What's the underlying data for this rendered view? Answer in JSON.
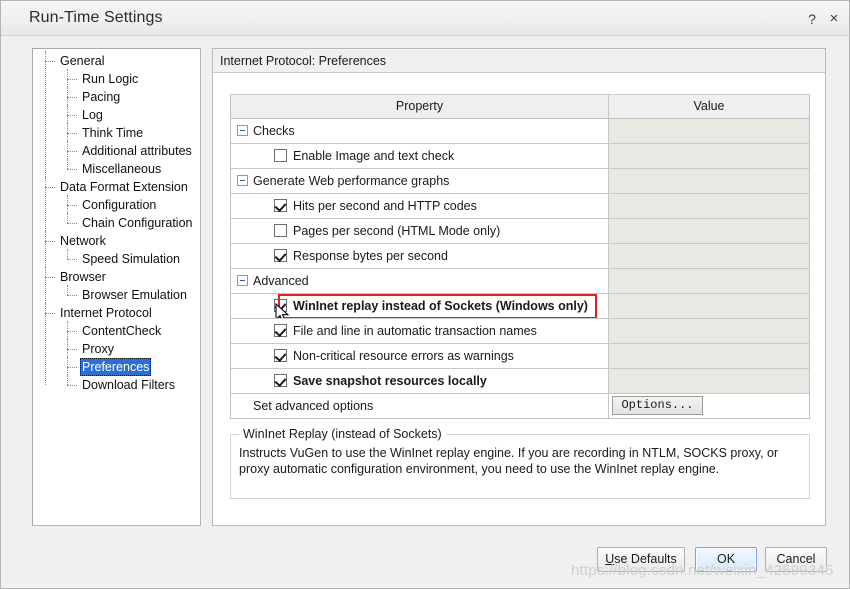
{
  "window": {
    "title": "Run-Time Settings",
    "help_icon": "?",
    "close_icon": "×"
  },
  "tree": {
    "nodes": [
      {
        "label": "General",
        "level": 0,
        "selected": false
      },
      {
        "label": "Run Logic",
        "level": 1,
        "selected": false
      },
      {
        "label": "Pacing",
        "level": 1,
        "selected": false
      },
      {
        "label": "Log",
        "level": 1,
        "selected": false
      },
      {
        "label": "Think Time",
        "level": 1,
        "selected": false
      },
      {
        "label": "Additional attributes",
        "level": 1,
        "selected": false
      },
      {
        "label": "Miscellaneous",
        "level": 1,
        "selected": false
      },
      {
        "label": "Data Format Extension",
        "level": 0,
        "selected": false
      },
      {
        "label": "Configuration",
        "level": 1,
        "selected": false
      },
      {
        "label": "Chain Configuration",
        "level": 1,
        "selected": false
      },
      {
        "label": "Network",
        "level": 0,
        "selected": false
      },
      {
        "label": "Speed Simulation",
        "level": 1,
        "selected": false
      },
      {
        "label": "Browser",
        "level": 0,
        "selected": false
      },
      {
        "label": "Browser Emulation",
        "level": 1,
        "selected": false
      },
      {
        "label": "Internet Protocol",
        "level": 0,
        "selected": false
      },
      {
        "label": "ContentCheck",
        "level": 1,
        "selected": false
      },
      {
        "label": "Proxy",
        "level": 1,
        "selected": false
      },
      {
        "label": "Preferences",
        "level": 1,
        "selected": true
      },
      {
        "label": "Download Filters",
        "level": 1,
        "selected": false
      }
    ]
  },
  "panel": {
    "header": "Internet Protocol: Preferences"
  },
  "grid": {
    "columns": {
      "property": "Property",
      "value": "Value"
    },
    "rows": [
      {
        "kind": "group",
        "label": "Checks",
        "expander": "-",
        "value": ""
      },
      {
        "kind": "checkbox",
        "label": "Enable Image and text check",
        "checked": false,
        "bold": false,
        "value": ""
      },
      {
        "kind": "group",
        "label": "Generate Web performance graphs",
        "expander": "-",
        "value": ""
      },
      {
        "kind": "checkbox",
        "label": "Hits per second and HTTP codes",
        "checked": true,
        "bold": false,
        "value": ""
      },
      {
        "kind": "checkbox",
        "label": "Pages per second (HTML Mode only)",
        "checked": false,
        "bold": false,
        "value": ""
      },
      {
        "kind": "checkbox",
        "label": "Response bytes per second",
        "checked": true,
        "bold": false,
        "value": ""
      },
      {
        "kind": "group",
        "label": "Advanced",
        "expander": "-",
        "value": ""
      },
      {
        "kind": "checkbox",
        "label": "WinInet replay instead of Sockets (Windows only)",
        "checked": true,
        "bold": true,
        "value": "",
        "highlighted": true
      },
      {
        "kind": "checkbox",
        "label": "File and line in automatic transaction names",
        "checked": true,
        "bold": false,
        "value": ""
      },
      {
        "kind": "checkbox",
        "label": "Non-critical resource errors as warnings",
        "checked": true,
        "bold": false,
        "value": ""
      },
      {
        "kind": "checkbox",
        "label": "Save snapshot resources locally",
        "checked": true,
        "bold": true,
        "value": ""
      },
      {
        "kind": "plain",
        "label": "Set advanced options",
        "value": "Options...",
        "value_is_button": true
      }
    ]
  },
  "description": {
    "title": "WinInet Replay (instead of Sockets)",
    "body": "Instructs VuGen to use the WinInet replay engine. If you are recording in NTLM, SOCKS proxy, or proxy automatic configuration environment, you need to use the WinInet replay engine."
  },
  "footer": {
    "use_defaults": "Use Defaults",
    "ok": "OK",
    "cancel": "Cancel"
  },
  "watermark": "https://blog.csdn.net/weixin_42599345",
  "colors": {
    "accent": "#2c6fd1",
    "highlight": "#e02020",
    "value_cell": "#e9e9e3",
    "titlebar": "#efefef"
  }
}
